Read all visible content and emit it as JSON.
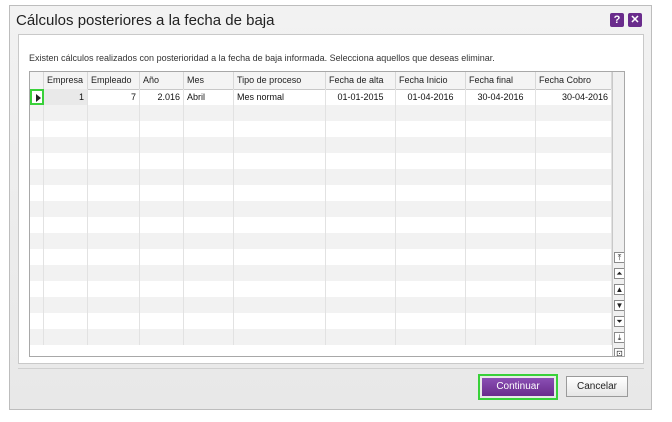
{
  "dialog": {
    "title": "Cálculos posteriores a la fecha de baja",
    "help_glyph": "?",
    "close_glyph": "✕",
    "message": "Existen cálculos realizados con posterioridad a la fecha de baja informada.  Selecciona aquellos que deseas eliminar."
  },
  "table": {
    "columns": [
      "Empresa",
      "Empleado",
      "Año",
      "Mes",
      "Tipo de proceso",
      "Fecha de alta",
      "Fecha Inicio",
      "Fecha final",
      "Fecha Cobro"
    ],
    "rows": [
      [
        "1",
        "7",
        "2.016",
        "Abril",
        "Mes normal",
        "01-01-2015",
        "01-04-2016",
        "30-04-2016",
        "30-04-2016"
      ]
    ]
  },
  "scrollbar": {
    "glyphs": [
      "⤒",
      "⏶",
      "▲",
      "▼",
      "⏷",
      "⤓",
      "⊡"
    ]
  },
  "buttons": {
    "continuar": "Continuar",
    "cancelar": "Cancelar"
  },
  "colors": {
    "accent": "#6a2c8c",
    "highlight": "#39d13a"
  }
}
